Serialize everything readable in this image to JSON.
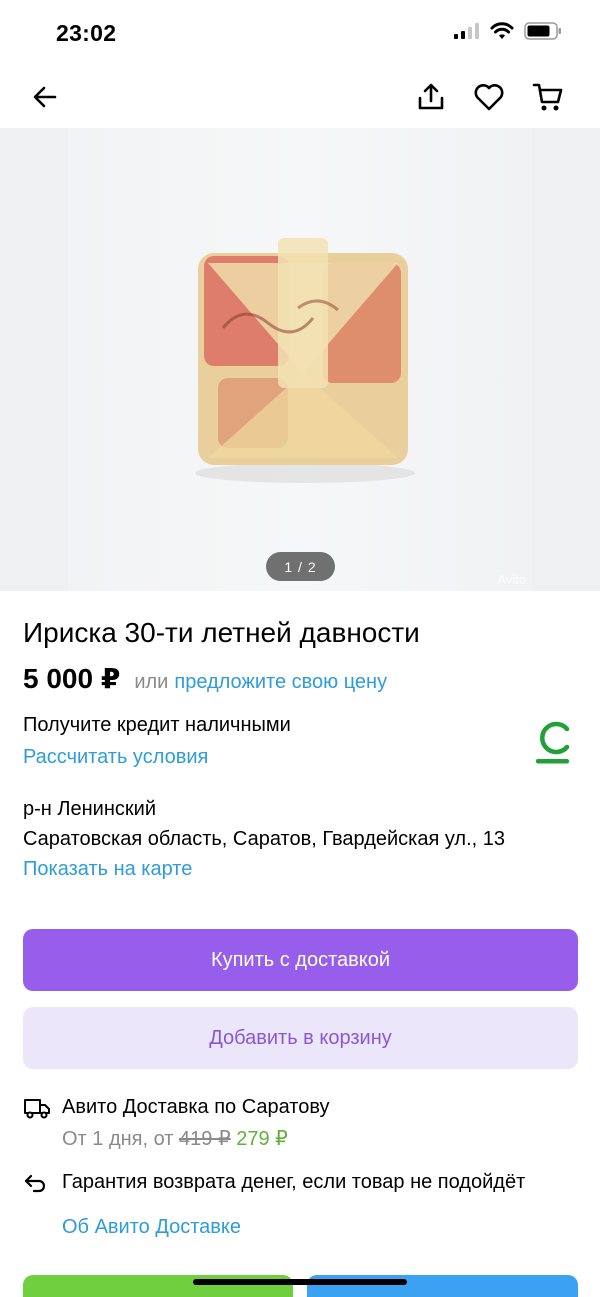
{
  "status_bar": {
    "time": "23:02"
  },
  "gallery": {
    "counter": "1 / 2",
    "watermark": "Avito"
  },
  "listing": {
    "title": "Ириска 30-ти летней давности",
    "price": "5 000 ₽",
    "price_or": "или",
    "offer_link": "предложите свою цену"
  },
  "credit": {
    "title": "Получите кредит наличными",
    "link": "Рассчитать условия",
    "logo_color": "#21a038"
  },
  "location": {
    "district": "р-н Ленинский",
    "address": "Саратовская область, Саратов, Гвардейская ул., 13",
    "map_link": "Показать на карте"
  },
  "buttons": {
    "buy_label": "Купить с доставкой",
    "cart_label": "Добавить в корзину"
  },
  "delivery": {
    "title": "Авито Доставка по Саратову",
    "terms_prefix": "От 1 дня, от",
    "old_price": "419 ₽",
    "new_price": "279 ₽"
  },
  "guarantee": {
    "text": "Гарантия возврата денег, если товар не подойдёт",
    "about_link": "Об Авито Доставке"
  },
  "colors": {
    "accent_link": "#2d9cdb",
    "buy_button": "#965eeb",
    "cart_button": "#ece6fb",
    "discount_price": "#5fb33a"
  }
}
